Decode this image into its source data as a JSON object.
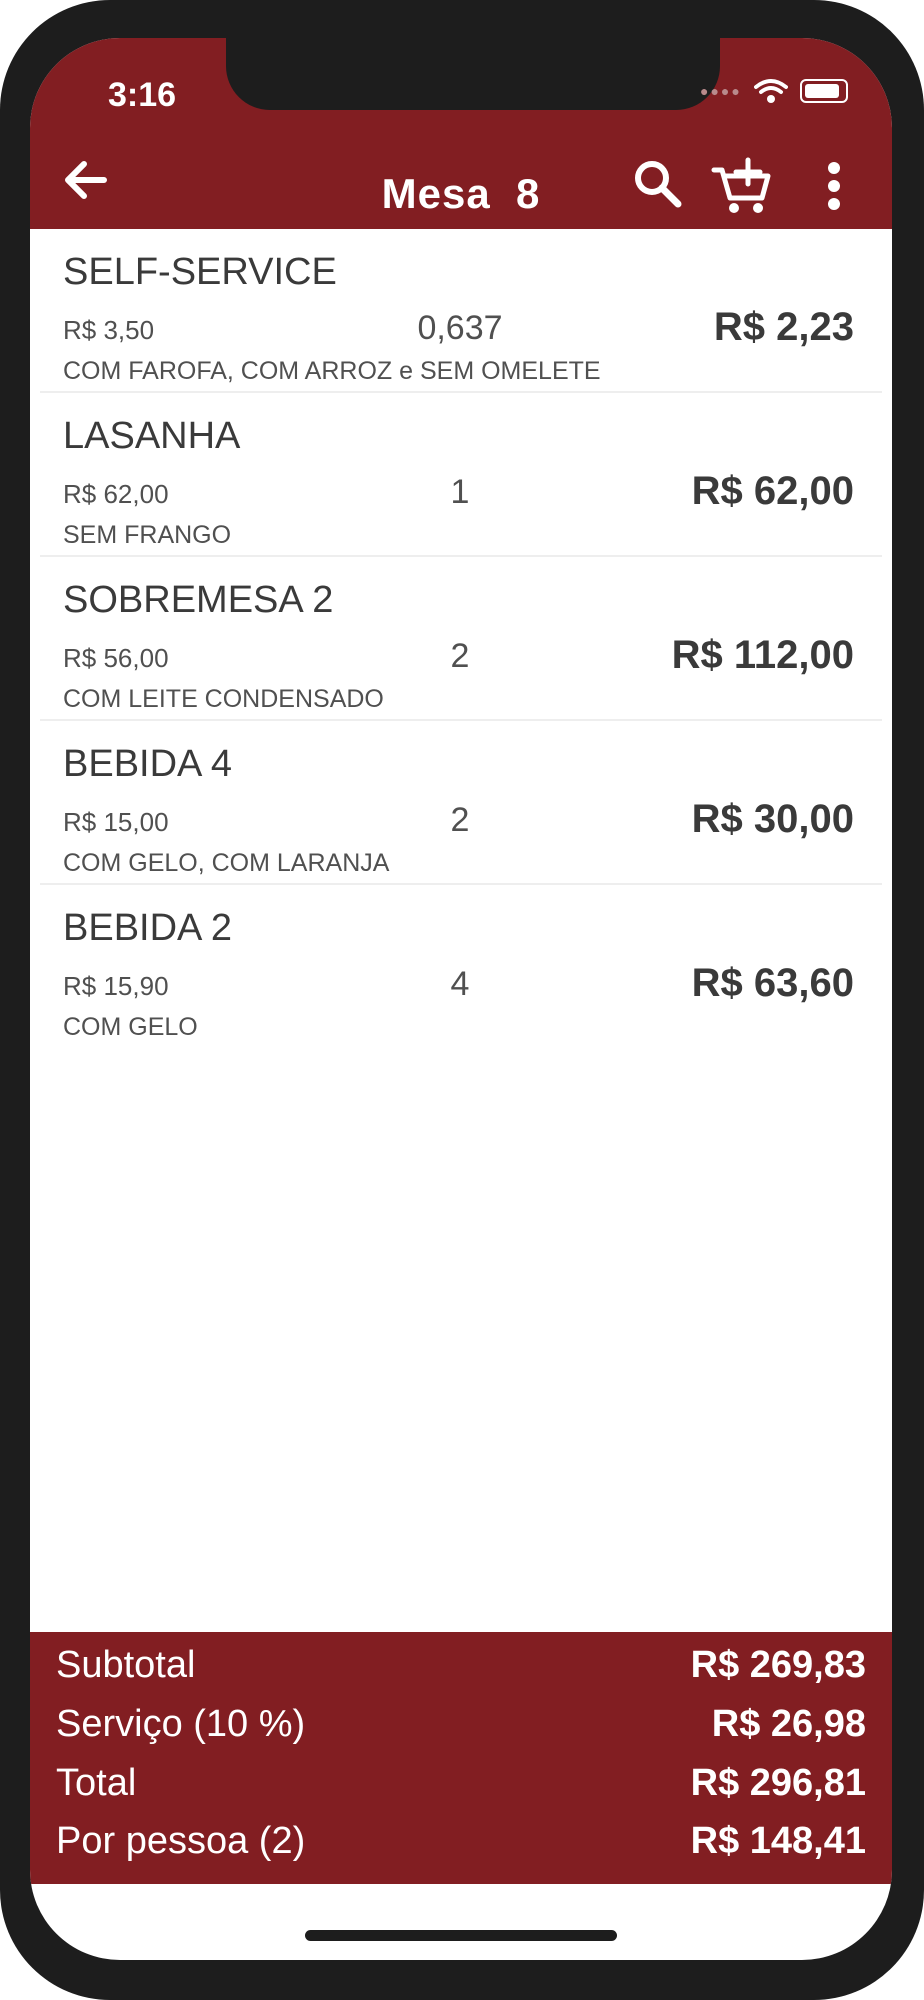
{
  "status": {
    "time": "3:16"
  },
  "header": {
    "title": "Mesa  8"
  },
  "items": [
    {
      "name": "SELF-SERVICE",
      "unit_price": "R$ 3,50",
      "qty": "0,637",
      "total": "R$ 2,23",
      "note": "COM FAROFA, COM ARROZ e SEM OMELETE"
    },
    {
      "name": "LASANHA",
      "unit_price": "R$ 62,00",
      "qty": "1",
      "total": "R$ 62,00",
      "note": "SEM FRANGO"
    },
    {
      "name": "SOBREMESA 2",
      "unit_price": "R$ 56,00",
      "qty": "2",
      "total": "R$ 112,00",
      "note": "COM LEITE CONDENSADO"
    },
    {
      "name": "BEBIDA 4",
      "unit_price": "R$ 15,00",
      "qty": "2",
      "total": "R$ 30,00",
      "note": "COM GELO, COM LARANJA"
    },
    {
      "name": "BEBIDA 2",
      "unit_price": "R$ 15,90",
      "qty": "4",
      "total": "R$ 63,60",
      "note": "COM GELO"
    }
  ],
  "summary": {
    "subtotal_label": "Subtotal",
    "subtotal_value": "R$ 269,83",
    "service_label": "Serviço (10 %)",
    "service_value": "R$ 26,98",
    "total_label": "Total",
    "total_value": "R$ 296,81",
    "per_person_label": "Por pessoa (2)",
    "per_person_value": "R$ 148,41"
  },
  "icons": {
    "back": "arrow-left-icon",
    "search": "search-icon",
    "cart": "cart-plus-icon",
    "more": "more-vertical-icon",
    "wifi": "wifi-icon",
    "battery": "battery-icon"
  },
  "colors": {
    "accent": "#821e22",
    "bezel": "#1d1d1d",
    "background": "#ffffff"
  }
}
